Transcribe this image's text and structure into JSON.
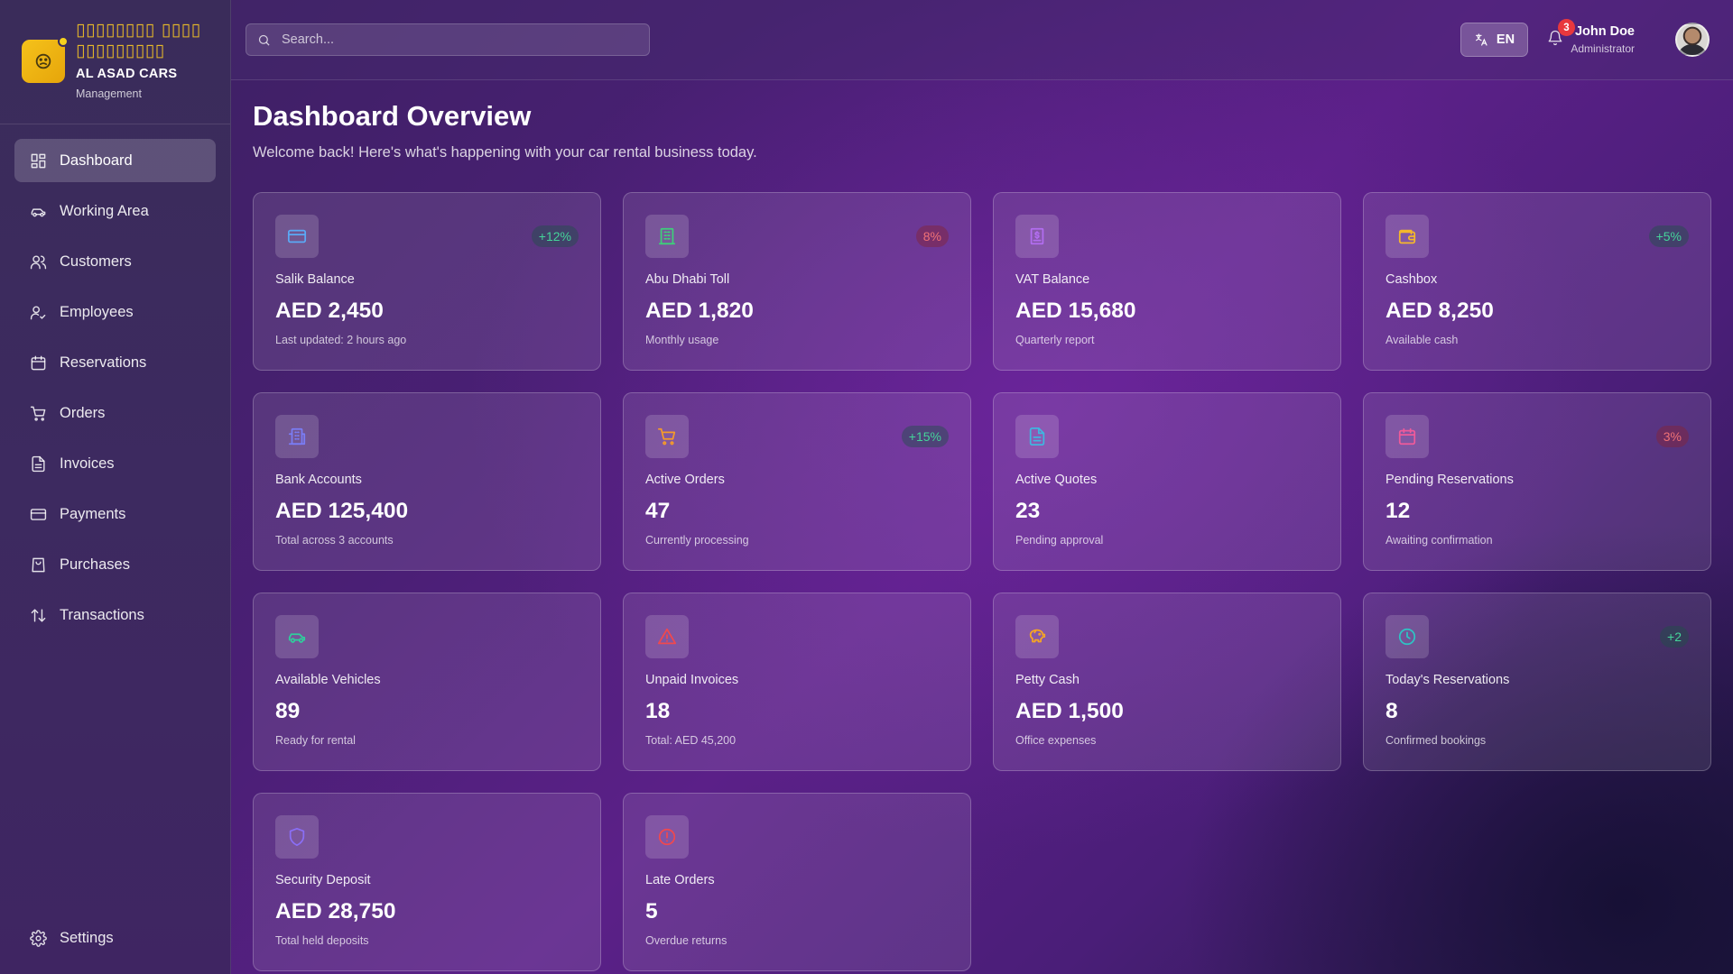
{
  "brand": {
    "arabic_title": "▯▯▯▯▯▯▯▯ ▯▯▯▯▯▯▯▯▯▯▯▯▯",
    "name": "AL ASAD CARS",
    "subtitle": "Management",
    "logo_icon": "sad-face-icon",
    "accent_color": "#f5c21b"
  },
  "sidebar": {
    "items": [
      {
        "label": "Dashboard",
        "icon": "grid-icon",
        "active": true
      },
      {
        "label": "Working Area",
        "icon": "car-icon",
        "active": false
      },
      {
        "label": "Customers",
        "icon": "users-icon",
        "active": false
      },
      {
        "label": "Employees",
        "icon": "user-check-icon",
        "active": false
      },
      {
        "label": "Reservations",
        "icon": "calendar-icon",
        "active": false
      },
      {
        "label": "Orders",
        "icon": "cart-icon",
        "active": false
      },
      {
        "label": "Invoices",
        "icon": "file-icon",
        "active": false
      },
      {
        "label": "Payments",
        "icon": "credit-card-icon",
        "active": false
      },
      {
        "label": "Purchases",
        "icon": "shopping-bag-icon",
        "active": false
      },
      {
        "label": "Transactions",
        "icon": "arrows-up-down-icon",
        "active": false
      }
    ],
    "settings_label": "Settings"
  },
  "header": {
    "search_placeholder": "Search...",
    "language": "EN",
    "notification_count": "3",
    "user_name": "John Doe",
    "user_role": "Administrator"
  },
  "main": {
    "title": "Dashboard Overview",
    "subtitle": "Welcome back! Here's what's happening with your car rental business today.",
    "cards": [
      {
        "label": "Salik Balance",
        "value": "AED 2,450",
        "note": "Last updated: 2 hours ago",
        "trend": "+12%",
        "trend_dir": "up",
        "icon": "credit-card-icon",
        "icon_color": "#5aa9f5"
      },
      {
        "label": "Abu Dhabi Toll",
        "value": "AED 1,820",
        "note": "Monthly usage",
        "trend": "8%",
        "trend_dir": "down",
        "icon": "building-icon",
        "icon_color": "#3ecf7a"
      },
      {
        "label": "VAT Balance",
        "value": "AED 15,680",
        "note": "Quarterly report",
        "trend": "",
        "trend_dir": "",
        "icon": "receipt-icon",
        "icon_color": "#b26df0"
      },
      {
        "label": "Cashbox",
        "value": "AED 8,250",
        "note": "Available cash",
        "trend": "+5%",
        "trend_dir": "up",
        "icon": "wallet-icon",
        "icon_color": "#f5b82a"
      },
      {
        "label": "Bank Accounts",
        "value": "AED 125,400",
        "note": "Total across 3 accounts",
        "trend": "",
        "trend_dir": "",
        "icon": "bank-icon",
        "icon_color": "#7a7df5"
      },
      {
        "label": "Active Orders",
        "value": "47",
        "note": "Currently processing",
        "trend": "+15%",
        "trend_dir": "up",
        "icon": "cart-icon",
        "icon_color": "#f59a2a"
      },
      {
        "label": "Active Quotes",
        "value": "23",
        "note": "Pending approval",
        "trend": "",
        "trend_dir": "",
        "icon": "document-icon",
        "icon_color": "#3fb6e0"
      },
      {
        "label": "Pending Reservations",
        "value": "12",
        "note": "Awaiting confirmation",
        "trend": "3%",
        "trend_dir": "down",
        "icon": "calendar-icon",
        "icon_color": "#ef5a9a"
      },
      {
        "label": "Available Vehicles",
        "value": "89",
        "note": "Ready for rental",
        "trend": "",
        "trend_dir": "",
        "icon": "car-icon",
        "icon_color": "#2fcf9c"
      },
      {
        "label": "Unpaid Invoices",
        "value": "18",
        "note": "Total: AED 45,200",
        "trend": "",
        "trend_dir": "",
        "icon": "warning-icon",
        "icon_color": "#f0484e"
      },
      {
        "label": "Petty Cash",
        "value": "AED 1,500",
        "note": "Office expenses",
        "trend": "",
        "trend_dir": "",
        "icon": "piggy-bank-icon",
        "icon_color": "#f5a524"
      },
      {
        "label": "Today's Reservations",
        "value": "8",
        "note": "Confirmed bookings",
        "trend": "+2",
        "trend_dir": "up",
        "icon": "clock-icon",
        "icon_color": "#2ec4c4"
      },
      {
        "label": "Security Deposit",
        "value": "AED 28,750",
        "note": "Total held deposits",
        "trend": "",
        "trend_dir": "",
        "icon": "shield-icon",
        "icon_color": "#8a6ef5"
      },
      {
        "label": "Late Orders",
        "value": "5",
        "note": "Overdue returns",
        "trend": "",
        "trend_dir": "",
        "icon": "alert-circle-icon",
        "icon_color": "#f0484e"
      }
    ]
  }
}
